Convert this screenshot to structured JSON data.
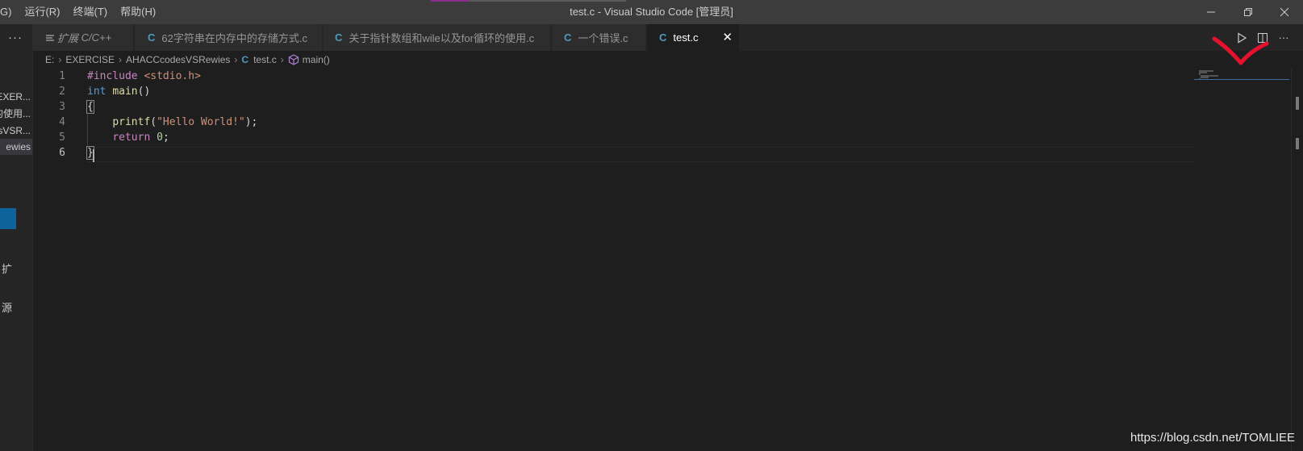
{
  "titlebar": {
    "menus": [
      "G)",
      "运行(R)",
      "终端(T)",
      "帮助(H)"
    ],
    "title": "test.c - Visual Studio Code [管理员]"
  },
  "sidebar": {
    "more": "···",
    "items": [
      "\\EXER...",
      "的使用...",
      "esVSR...",
      "ewies"
    ],
    "labels": [
      "扩",
      "源"
    ]
  },
  "tabs": [
    {
      "prefix": "扩展",
      "label": "C/C++",
      "icon": "list-icon",
      "active": false
    },
    {
      "label": "62字符串在内存中的存储方式.c",
      "icon": "c-file-icon",
      "active": false
    },
    {
      "label": "关于指针数组和wile以及for循环的使用.c",
      "icon": "c-file-icon",
      "active": false
    },
    {
      "label": "一个错误.c",
      "icon": "c-file-icon",
      "active": false
    },
    {
      "label": "test.c",
      "icon": "c-file-icon",
      "active": true,
      "close": "✕"
    }
  ],
  "breadcrumb": {
    "drive": "E:",
    "folder1": "EXERCISE",
    "folder2": "AHACCcodesVSRewies",
    "file": "test.c",
    "symbol": "main()"
  },
  "code": {
    "line_numbers": [
      "1",
      "2",
      "3",
      "4",
      "5",
      "6"
    ],
    "current_line": 6,
    "l1_directive": "#include",
    "l1_header": "<stdio.h>",
    "l2_type": "int",
    "l2_fn": "main",
    "l2_parens": "()",
    "l3_brace": "{",
    "l4_indent": "    ",
    "l4_fn": "printf",
    "l4_open": "(",
    "l4_str": "\"Hello World!\"",
    "l4_close": ");",
    "l5_indent": "    ",
    "l5_kw": "return",
    "l5_num": "0",
    "l5_semi": ";",
    "l6_brace": "}"
  },
  "watermark": "https://blog.csdn.net/TOMLIEE",
  "colors": {
    "editor_bg": "#1e1e1e",
    "titlebar_bg": "#3c3c3c",
    "tab_active_bg": "#1e1e1e",
    "c_icon": "#519aba",
    "annotation_red": "#e8112d"
  }
}
